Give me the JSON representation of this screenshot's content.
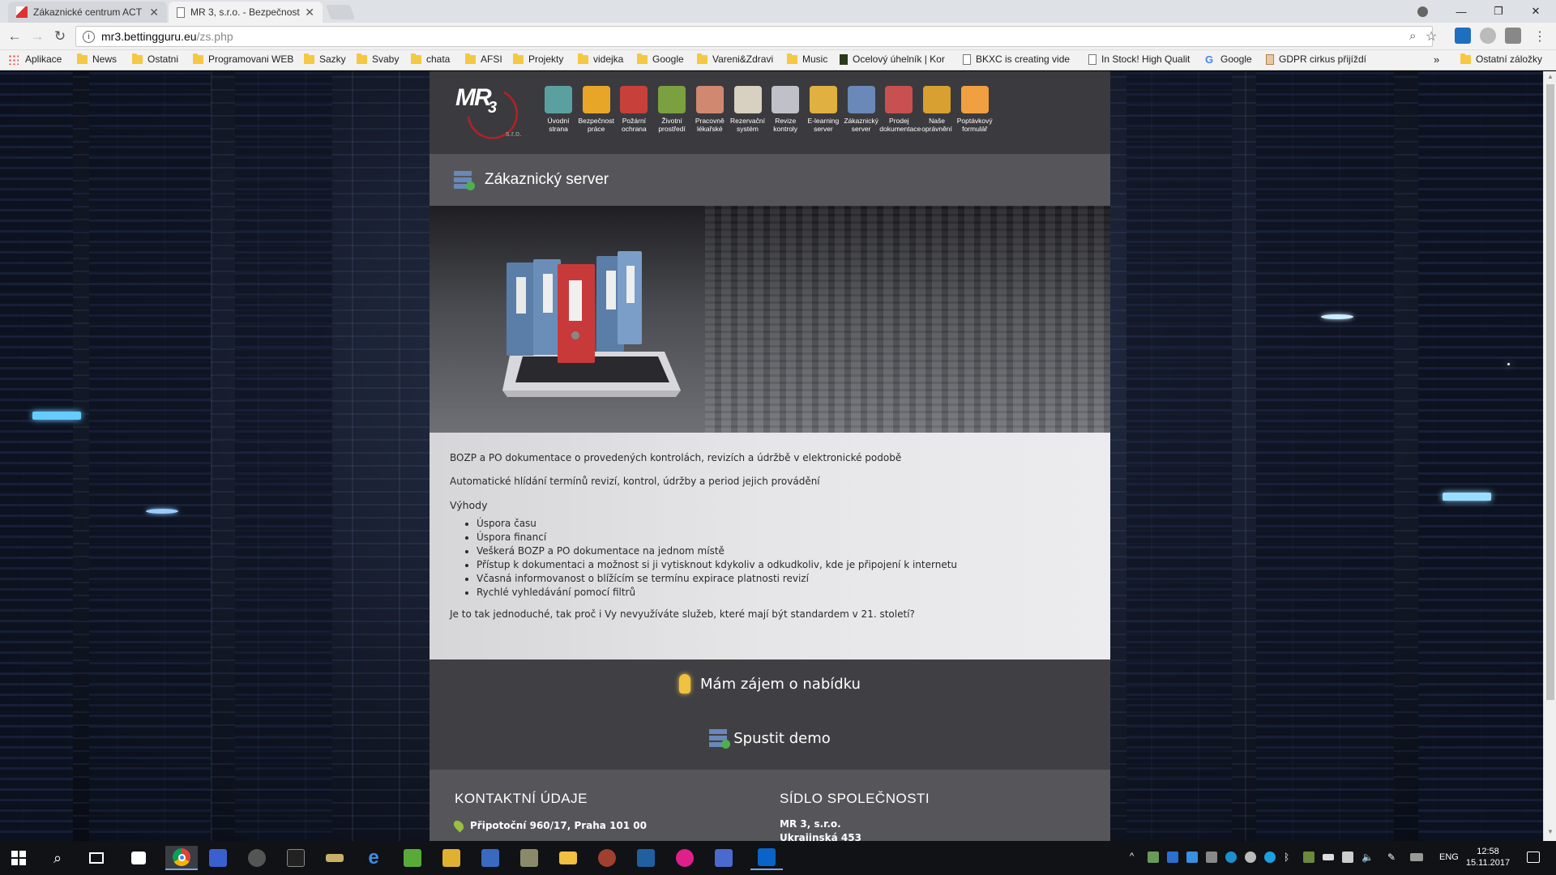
{
  "browser": {
    "tabs": [
      {
        "label": "Zákaznické centrum ACT",
        "active": false
      },
      {
        "label": "MR 3, s.r.o. - Bezpečnost",
        "active": true
      }
    ],
    "url_host": "mr3.bettingguru.eu",
    "url_path": "/zs.php",
    "bookmarks": [
      {
        "label": "Aplikace",
        "type": "apps"
      },
      {
        "label": "News",
        "type": "folder"
      },
      {
        "label": "Ostatni",
        "type": "folder"
      },
      {
        "label": "Programovani WEB",
        "type": "folder"
      },
      {
        "label": "Sazky",
        "type": "folder"
      },
      {
        "label": "Svaby",
        "type": "folder"
      },
      {
        "label": "chata",
        "type": "folder"
      },
      {
        "label": "AFSI",
        "type": "folder"
      },
      {
        "label": "Projekty",
        "type": "folder"
      },
      {
        "label": "videjka",
        "type": "folder"
      },
      {
        "label": "Google",
        "type": "folder"
      },
      {
        "label": "Vareni&Zdravi",
        "type": "folder"
      },
      {
        "label": "Music",
        "type": "folder"
      },
      {
        "label": "Ocelový úhelník | Kor",
        "type": "page"
      },
      {
        "label": "BKXC is creating vide",
        "type": "page"
      },
      {
        "label": "In Stock! High Qualit",
        "type": "page"
      },
      {
        "label": "Google",
        "type": "google"
      },
      {
        "label": "GDPR cirkus přijíždí",
        "type": "page"
      }
    ],
    "bookmarks_more": "»",
    "other_bookmarks": "Ostatní záložky"
  },
  "site": {
    "logo_text": "MR",
    "logo_sub": "3",
    "logo_caption": "s.r.o.",
    "nav": [
      {
        "label": "Úvodní strana",
        "icon": "home-icon",
        "color": "#5aa0a0"
      },
      {
        "label": "Bezpečnost práce",
        "icon": "hard-hat-icon",
        "color": "#e8a628"
      },
      {
        "label": "Požární ochrana",
        "icon": "fire-extinguisher-icon",
        "color": "#c8403a"
      },
      {
        "label": "Životní prostředí",
        "icon": "plant-icon",
        "color": "#7aa040"
      },
      {
        "label": "Pracovně lékařské",
        "icon": "doctor-icon",
        "color": "#d08870"
      },
      {
        "label": "Rezervační systém",
        "icon": "calendar-icon",
        "color": "#d8d0c0"
      },
      {
        "label": "Revize kontroly",
        "icon": "inspector-icon",
        "color": "#c0c0c8"
      },
      {
        "label": "E-learning server",
        "icon": "elearning-icon",
        "color": "#e0b040"
      },
      {
        "label": "Zákaznický server",
        "icon": "customer-server-icon",
        "color": "#6a88b8"
      },
      {
        "label": "Prodej dokumentace",
        "icon": "binders-icon",
        "color": "#c85050"
      },
      {
        "label": "Naše oprávnění",
        "icon": "certificate-icon",
        "color": "#d8a030"
      },
      {
        "label": "Poptávkový formulář",
        "icon": "envelope-icon",
        "color": "#f0a040"
      }
    ],
    "page_title": "Zákaznický server",
    "paragraph1": "BOZP a PO dokumentace o provedených kontrolách, revizích a údržbě v elektronické podobě",
    "paragraph2": "Automatické hlídání termínů revizí, kontrol, údržby a period jejich provádění",
    "benefits_heading": "Výhody",
    "benefits": [
      "Úspora času",
      "Úspora financí",
      "Veškerá BOZP a PO dokumentace na jednom místě",
      "Přístup k dokumentaci a možnost si ji vytisknout kdykoliv a odkudkoliv, kde je připojení k internetu",
      "Včasná informovanost o blížícím se termínu expirace platnosti revizí",
      "Rychlé vyhledávání pomocí filtrů"
    ],
    "closing": "Je to tak jednoduché, tak proč i Vy nevyužíváte služeb, které mají být standardem v 21. století?",
    "cta_offer": "Mám zájem o nabídku",
    "cta_demo": "Spustit demo",
    "contact_heading": "KONTAKTNÍ ÚDAJE",
    "contact_address": "Připotoční 960/17, Praha 101 00",
    "seat_heading": "SÍDLO SPOLEČNOSTI",
    "seat_name": "MR 3, s.r.o.",
    "seat_street": "Ukrajinská 453"
  },
  "taskbar": {
    "language": "ENG",
    "time": "12:58",
    "date": "15.11.2017"
  }
}
